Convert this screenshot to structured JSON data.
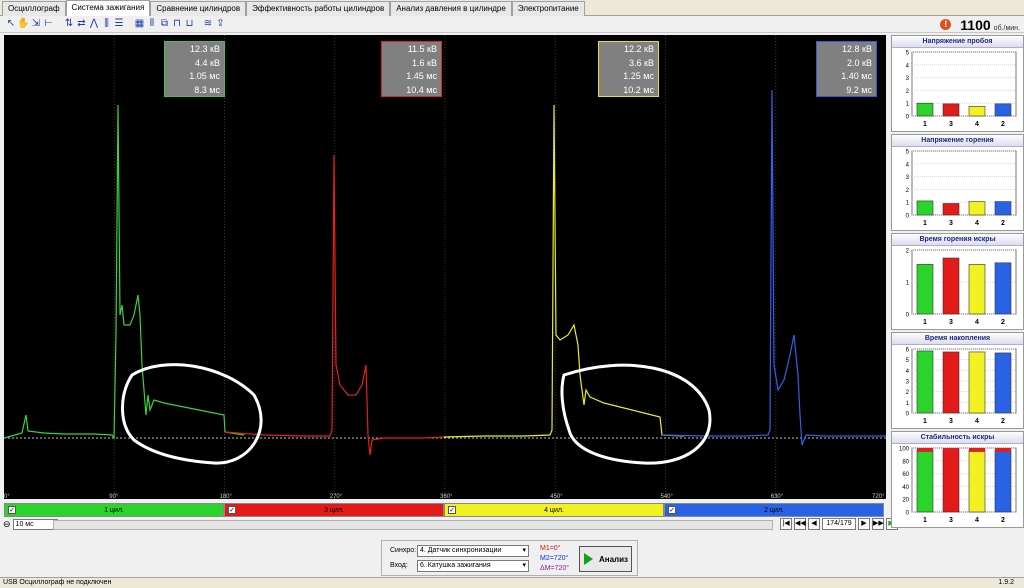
{
  "tabs": [
    {
      "label": "Осциллограф",
      "active": false
    },
    {
      "label": "Система зажигания",
      "active": true
    },
    {
      "label": "Сравнение цилиндров",
      "active": false
    },
    {
      "label": "Эффективность работы цилиндров",
      "active": false
    },
    {
      "label": "Анализ давления в цилиндре",
      "active": false
    },
    {
      "label": "Электропитание",
      "active": false
    }
  ],
  "toolbar_icons": [
    "cursor-icon",
    "hand-icon",
    "marker-icon",
    "measure-icon",
    "tree-icon",
    "sync-icon",
    "peak-icon",
    "split-icon",
    "list-icon",
    "grid-icon",
    "parade-icon",
    "overlay-icon",
    "cylinder-icon",
    "cylinder2-icon",
    "compare-icon",
    "export-icon"
  ],
  "rpm": {
    "value": "1100",
    "unit": "об./мин."
  },
  "scope": {
    "x_axis_labels": [
      "0°",
      "90°",
      "180°",
      "270°",
      "360°",
      "450°",
      "540°",
      "630°",
      "720°"
    ],
    "info_boxes": [
      {
        "color": "#3cc83c",
        "lines": [
          "12.3 кВ",
          "4.4 кВ",
          "1.05 мс",
          "8.3 мс"
        ]
      },
      {
        "color": "#e02020",
        "lines": [
          "11.5 кВ",
          "1.6 кВ",
          "1.45 мс",
          "10.4 мс"
        ]
      },
      {
        "color": "#e8e020",
        "lines": [
          "12.2 кВ",
          "3.6 кВ",
          "1.25 мс",
          "10.2 мс"
        ]
      },
      {
        "color": "#2a5ce0",
        "lines": [
          "12.8 кВ",
          "2.0 кВ",
          "1.40 мс",
          "9.2 мс"
        ]
      }
    ]
  },
  "cylinders": [
    {
      "label": "1 цил.",
      "color": "#2bd42b"
    },
    {
      "label": "3 цил.",
      "color": "#e21a1a"
    },
    {
      "label": "4 цил.",
      "color": "#f2f222"
    },
    {
      "label": "2 цил.",
      "color": "#2a62e6"
    }
  ],
  "timebase": {
    "value": "10 мс"
  },
  "navigation": {
    "counter": "174/179",
    "buttons": [
      "|◀",
      "◀◀",
      "◀",
      "▶",
      "▶▶",
      "▶|"
    ]
  },
  "controls": {
    "sync_label": "Синхро:",
    "sync_value": "4. Датчик синхронизации",
    "input_label": "Вход:",
    "input_value": "6. Катушка зажигания",
    "m1": "M1=0°",
    "m2": "M2=720°",
    "dm": "ΔM=720°",
    "analyze_label": "Анализ"
  },
  "status": {
    "text": "USB Осциллограф не подключен",
    "version": "1.9.2"
  },
  "panels": [
    {
      "title": "Напряжение пробоя",
      "y_ticks": [
        "5",
        "4",
        "3",
        "2",
        "1",
        "0"
      ],
      "ymax": 5,
      "categories": [
        "1",
        "3",
        "4",
        "2"
      ],
      "values": [
        1.0,
        0.95,
        0.75,
        0.95
      ]
    },
    {
      "title": "Напряжение горения",
      "y_ticks": [
        "5",
        "4",
        "3",
        "2",
        "1",
        "0"
      ],
      "ymax": 5,
      "categories": [
        "1",
        "3",
        "4",
        "2"
      ],
      "values": [
        1.1,
        0.9,
        1.05,
        1.05
      ]
    },
    {
      "title": "Время горения искры",
      "y_ticks": [
        "2",
        "1",
        "0"
      ],
      "ymax": 2,
      "categories": [
        "1",
        "3",
        "4",
        "2"
      ],
      "values": [
        1.55,
        1.75,
        1.55,
        1.6
      ]
    },
    {
      "title": "Время накопления",
      "y_ticks": [
        "6",
        "5",
        "4",
        "3",
        "2",
        "1",
        "0"
      ],
      "ymax": 6.5,
      "categories": [
        "1",
        "3",
        "4",
        "2"
      ],
      "values": [
        6.3,
        6.2,
        6.2,
        6.1
      ]
    },
    {
      "title": "Стабильность искры",
      "y_ticks": [
        "100",
        "80",
        "60",
        "40",
        "20",
        "0"
      ],
      "ymax": 100,
      "categories": [
        "1",
        "3",
        "4",
        "2"
      ],
      "values": [
        97,
        98,
        97,
        97
      ]
    }
  ]
}
